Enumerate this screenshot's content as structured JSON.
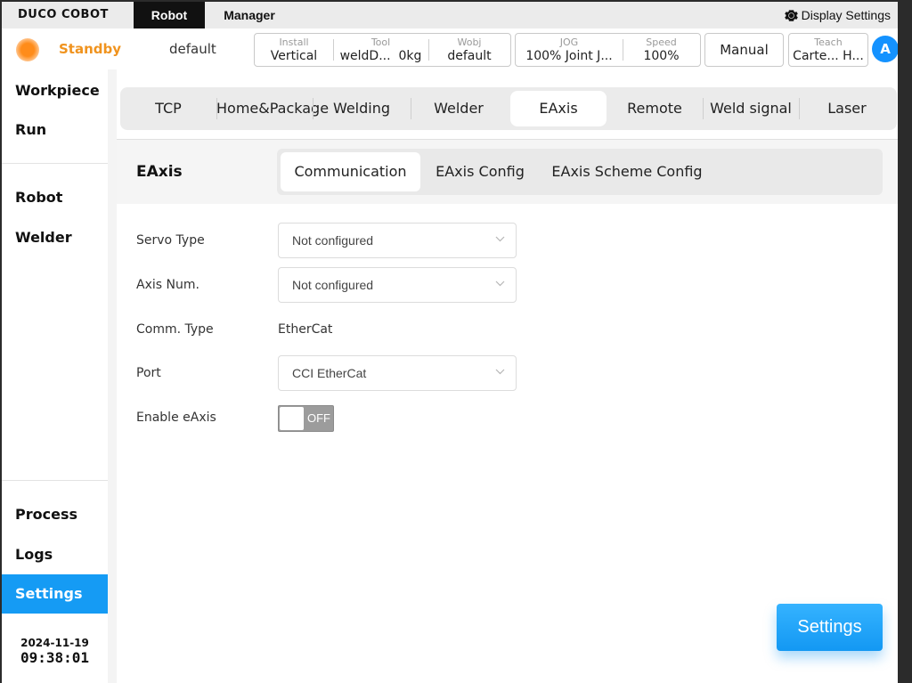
{
  "topbar": {
    "logo": "DUCO COBOT",
    "menu": [
      "Robot",
      "Manager"
    ],
    "display_settings": "Display Settings"
  },
  "status": {
    "state": "Standby",
    "state_color": "#f0931e",
    "project": "default",
    "install": {
      "label": "Install",
      "value": "Vertical"
    },
    "tool": {
      "label": "Tool",
      "value": "weldD...",
      "extra": "0kg"
    },
    "wobj": {
      "label": "Wobj",
      "value": "default"
    },
    "jog": {
      "label": "JOG",
      "value": "100% Joint J..."
    },
    "speed": {
      "label": "Speed",
      "value": "100%"
    },
    "mode": "Manual",
    "teach": {
      "label": "Teach",
      "value": "Carte... H..."
    },
    "avatar": "A"
  },
  "sidebar": {
    "items": [
      "Workpiece",
      "Run",
      "Robot",
      "Welder",
      "Process",
      "Logs",
      "Settings"
    ],
    "active": "Settings",
    "date": "2024-11-19",
    "time": "09:38:01"
  },
  "main_tabs": {
    "items": [
      "TCP",
      "Home&Package",
      "Welding",
      "Welder",
      "EAxis",
      "Remote",
      "Weld signal",
      "Laser"
    ],
    "active": "EAxis"
  },
  "section": {
    "title": "EAxis",
    "sub_tabs": [
      "Communication",
      "EAxis Config",
      "EAxis Scheme Config"
    ],
    "active_sub_tab": "Communication"
  },
  "form": {
    "servo_type": {
      "label": "Servo Type",
      "value": "Not configured"
    },
    "axis_num": {
      "label": "Axis Num.",
      "value": "Not configured"
    },
    "comm_type": {
      "label": "Comm. Type",
      "value": "EtherCat"
    },
    "port": {
      "label": "Port",
      "value": "CCI EtherCat"
    },
    "enable": {
      "label": "Enable eAxis",
      "value": "OFF"
    }
  },
  "actions": {
    "settings": "Settings"
  },
  "colors": {
    "accent": "#159bf4",
    "standby": "#f0931e",
    "avatar": "#1492ff"
  }
}
